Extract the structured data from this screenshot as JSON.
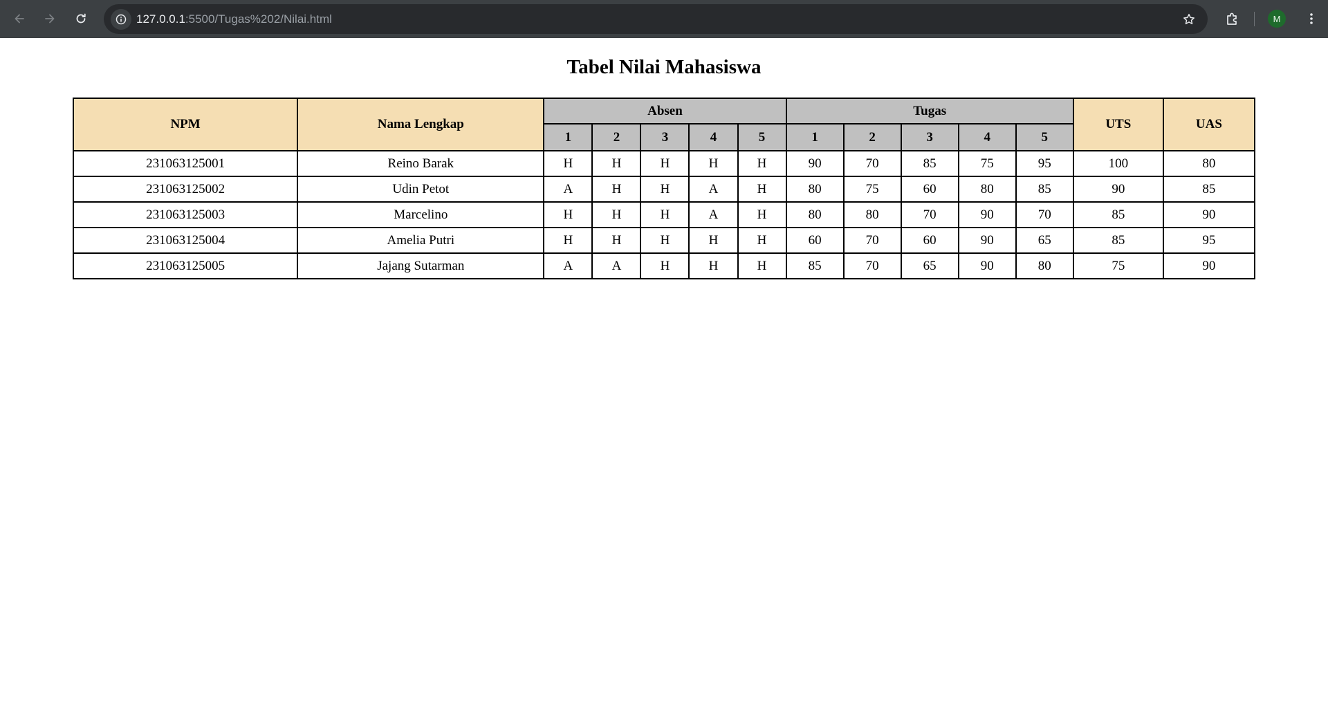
{
  "browser": {
    "url_host": "127.0.0.1",
    "url_rest": ":5500/Tugas%202/Nilai.html",
    "avatar_letter": "M"
  },
  "page": {
    "title": "Tabel Nilai Mahasiswa"
  },
  "table": {
    "headers": {
      "npm": "NPM",
      "nama": "Nama Lengkap",
      "absen": "Absen",
      "tugas": "Tugas",
      "uts": "UTS",
      "uas": "UAS",
      "absen_sub": [
        "1",
        "2",
        "3",
        "4",
        "5"
      ],
      "tugas_sub": [
        "1",
        "2",
        "3",
        "4",
        "5"
      ]
    },
    "rows": [
      {
        "npm": "231063125001",
        "nama": "Reino Barak",
        "absen": [
          "H",
          "H",
          "H",
          "H",
          "H"
        ],
        "tugas": [
          "90",
          "70",
          "85",
          "75",
          "95"
        ],
        "uts": "100",
        "uas": "80"
      },
      {
        "npm": "231063125002",
        "nama": "Udin Petot",
        "absen": [
          "A",
          "H",
          "H",
          "A",
          "H"
        ],
        "tugas": [
          "80",
          "75",
          "60",
          "80",
          "85"
        ],
        "uts": "90",
        "uas": "85"
      },
      {
        "npm": "231063125003",
        "nama": "Marcelino",
        "absen": [
          "H",
          "H",
          "H",
          "A",
          "H"
        ],
        "tugas": [
          "80",
          "80",
          "70",
          "90",
          "70"
        ],
        "uts": "85",
        "uas": "90"
      },
      {
        "npm": "231063125004",
        "nama": "Amelia Putri",
        "absen": [
          "H",
          "H",
          "H",
          "H",
          "H"
        ],
        "tugas": [
          "60",
          "70",
          "60",
          "90",
          "65"
        ],
        "uts": "85",
        "uas": "95"
      },
      {
        "npm": "231063125005",
        "nama": "Jajang Sutarman",
        "absen": [
          "A",
          "A",
          "H",
          "H",
          "H"
        ],
        "tugas": [
          "85",
          "70",
          "65",
          "90",
          "80"
        ],
        "uts": "75",
        "uas": "90"
      }
    ]
  },
  "colors": {
    "header_main": "#f5deb3",
    "header_group": "#c0c0c0",
    "browser_bar": "#3c4043"
  }
}
